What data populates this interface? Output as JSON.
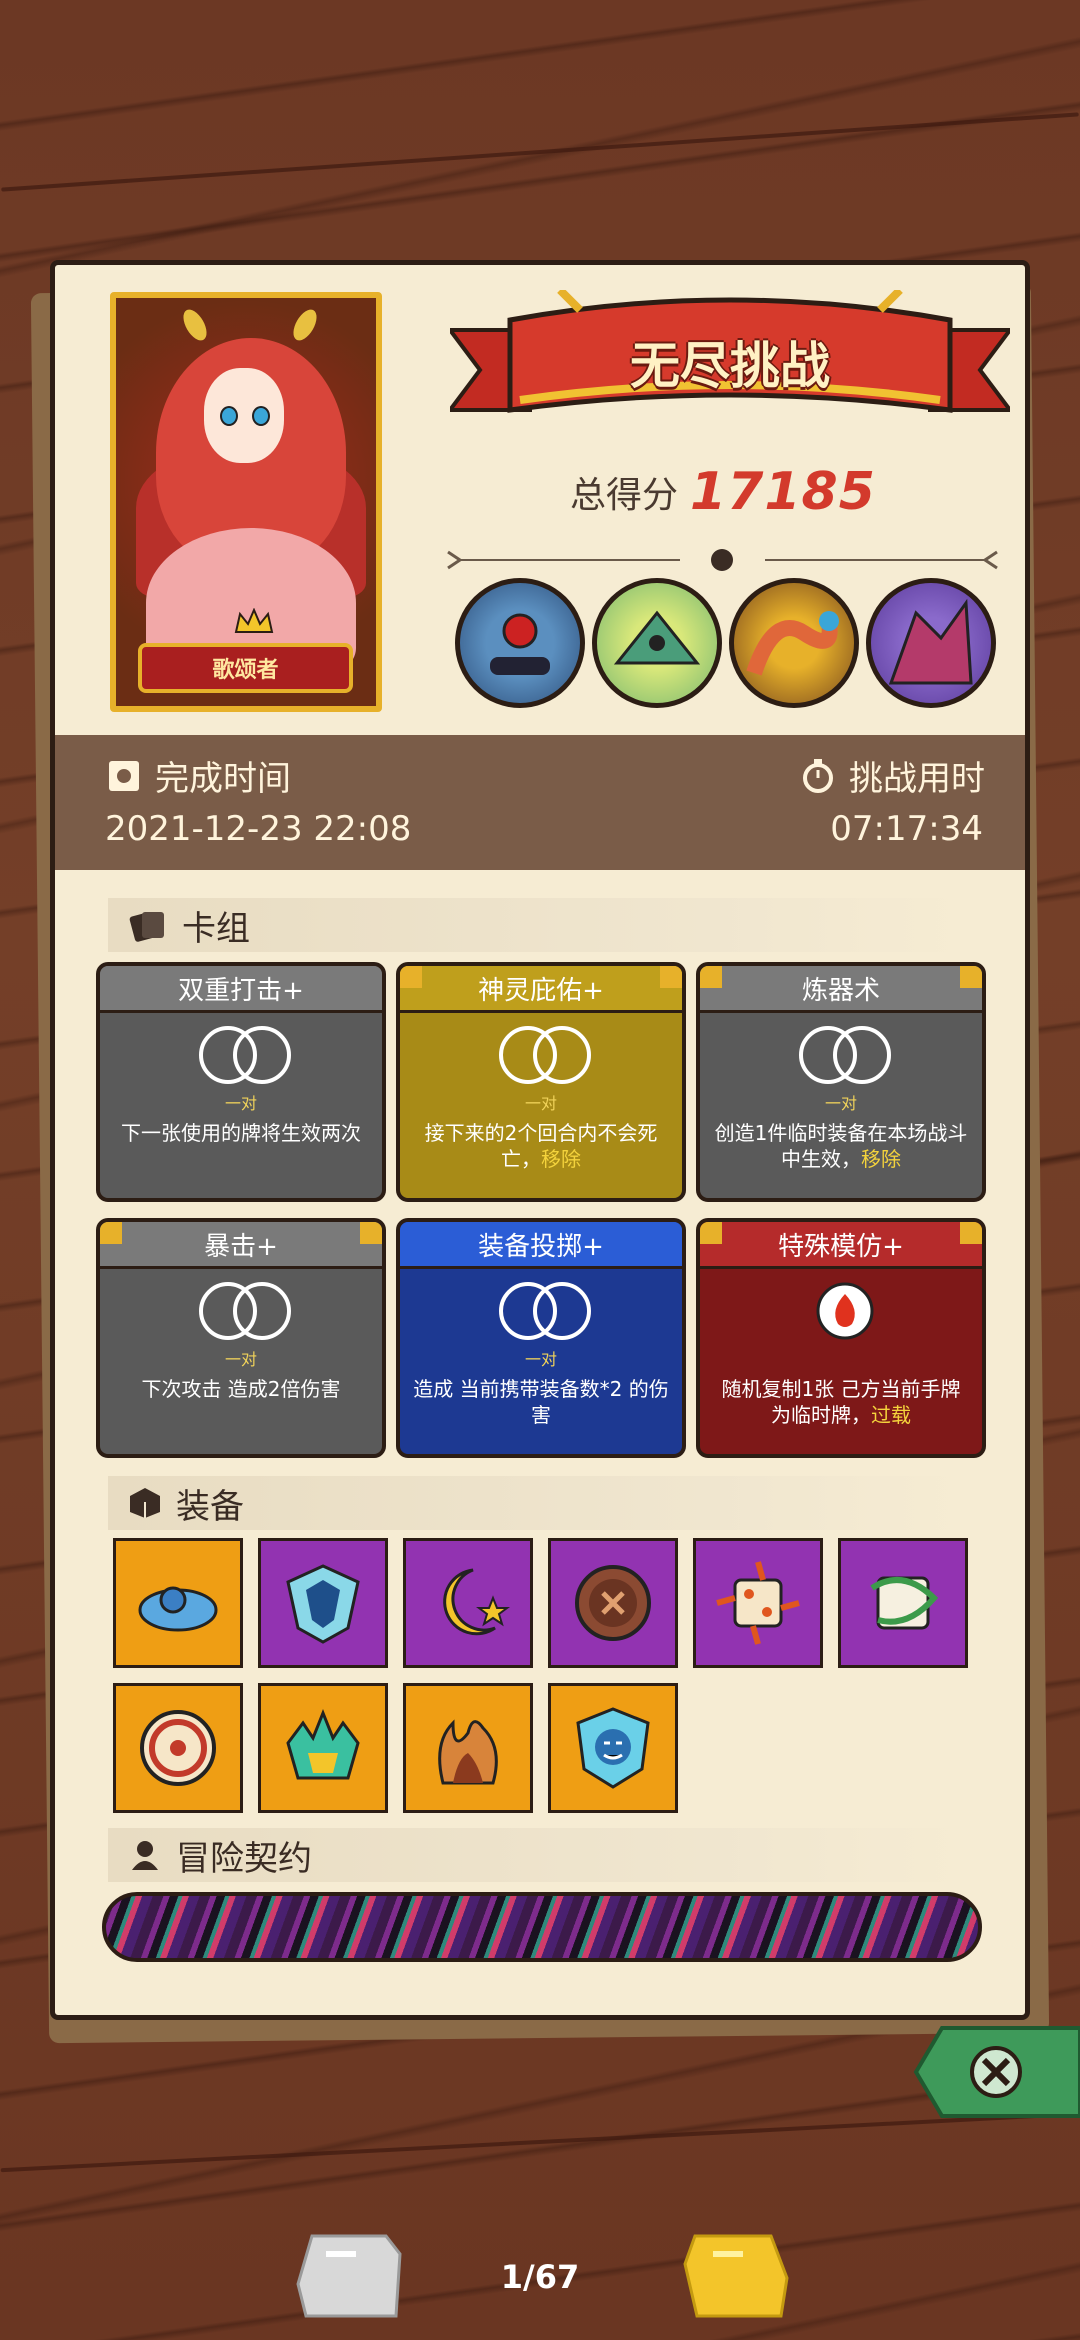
{
  "portrait": {
    "name": "歌颂者"
  },
  "mode": {
    "title": "无尽挑战"
  },
  "score": {
    "label": "总得分",
    "value": "17185"
  },
  "bosses": [
    {
      "icon": "blue-ogre-icon"
    },
    {
      "icon": "green-dragon-icon"
    },
    {
      "icon": "serpent-icon"
    },
    {
      "icon": "purple-beast-icon"
    }
  ],
  "time": {
    "complete_label": "完成时间",
    "complete_value": "2021-12-23 22:08",
    "duration_label": "挑战用时",
    "duration_value": "07:17:34"
  },
  "deck": {
    "title": "卡组",
    "cards": [
      {
        "name": "双重打击+",
        "color": "grey",
        "pair": "一对",
        "desc": "下一张使用的牌将生效两次",
        "hl": ""
      },
      {
        "name": "神灵庇佑+",
        "color": "gold",
        "pair": "一对",
        "desc": "接下来的2个回合内不会死亡，",
        "hl": "移除"
      },
      {
        "name": "炼器术",
        "color": "grey",
        "pair": "一对",
        "desc": "创造1件临时装备在本场战斗中生效，",
        "hl": "移除"
      },
      {
        "name": "暴击+",
        "color": "grey",
        "pair": "一对",
        "desc": "下次攻击 造成2倍伤害",
        "hl": ""
      },
      {
        "name": "装备投掷+",
        "color": "blue",
        "pair": "一对",
        "desc": "造成 当前携带装备数*2 的伤害",
        "hl": ""
      },
      {
        "name": "特殊模仿+",
        "color": "red",
        "pair": "",
        "desc": "随机复制1张 己方当前手牌 为临时牌，",
        "hl": "过载"
      }
    ]
  },
  "equipment": {
    "title": "装备",
    "items": [
      {
        "icon": "blue-slime-icon",
        "color": "orange"
      },
      {
        "icon": "blue-shield-icon",
        "color": "purple"
      },
      {
        "icon": "moon-star-icon",
        "color": "purple"
      },
      {
        "icon": "button-icon",
        "color": "purple"
      },
      {
        "icon": "spiked-dice-icon",
        "color": "purple"
      },
      {
        "icon": "vine-dice-icon",
        "color": "purple"
      },
      {
        "icon": "round-shield-icon",
        "color": "orange"
      },
      {
        "icon": "flame-mask-icon",
        "color": "orange"
      },
      {
        "icon": "flame-bundle-icon",
        "color": "orange"
      },
      {
        "icon": "pumpkin-shield-icon",
        "color": "orange"
      }
    ]
  },
  "contract": {
    "title": "冒险契约"
  },
  "pager": {
    "current": "1/67"
  }
}
